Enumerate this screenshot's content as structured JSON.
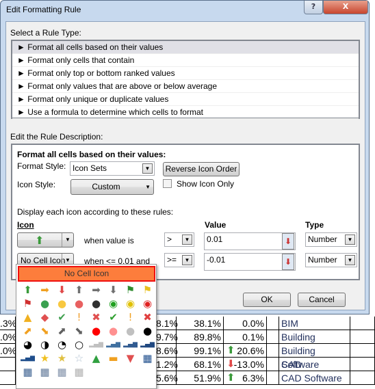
{
  "dialog": {
    "title": "Edit Formatting Rule",
    "help": "?",
    "close": "X"
  },
  "rule_type": {
    "label": "Select a Rule Type:",
    "items": [
      "► Format all cells based on their values",
      "► Format only cells that contain",
      "► Format only top or bottom ranked values",
      "► Format only values that are above or below average",
      "► Format only unique or duplicate values",
      "► Use a formula to determine which cells to format"
    ],
    "selected": 0
  },
  "description": {
    "label": "Edit the Rule Description:",
    "heading": "Format all cells based on their values:",
    "format_style_label": "Format Style:",
    "format_style": "Icon Sets",
    "reverse": "Reverse Icon Order",
    "icon_style_label": "Icon Style:",
    "icon_style": "Custom",
    "show_icon_only": "Show Icon Only",
    "show_icon_only_checked": false,
    "display_label": "Display each icon according to these rules:",
    "col_icon": "Icon",
    "col_value": "Value",
    "col_type": "Type",
    "rules": [
      {
        "icon": "green-up-arrow",
        "when": "when value is",
        "op": ">",
        "value": "0.01",
        "type": "Number"
      },
      {
        "icon": "No Cell Icon",
        "when": "when <= 0.01 and",
        "op": ">=",
        "value": "-0.01",
        "type": "Number"
      }
    ]
  },
  "buttons": {
    "ok": "OK",
    "cancel": "Cancel"
  },
  "icon_picker": {
    "selected": "No Cell Icon",
    "icons": [
      {
        "n": "green-up-arrow",
        "c": "#3a9a3a"
      },
      {
        "n": "yellow-right-arrow",
        "c": "#f0a020"
      },
      {
        "n": "red-down-arrow",
        "c": "#e04848"
      },
      {
        "n": "gray-up-arrow",
        "c": "#707070"
      },
      {
        "n": "gray-right-arrow",
        "c": "#707070"
      },
      {
        "n": "gray-down-arrow",
        "c": "#707070"
      },
      {
        "n": "green-flag",
        "c": "#2e8b2e"
      },
      {
        "n": "yellow-flag",
        "c": "#e8c020"
      },
      {
        "n": "red-flag",
        "c": "#d03030"
      },
      {
        "n": "green-circle",
        "c": "#3aa050"
      },
      {
        "n": "yellow-circle",
        "c": "#f8c840"
      },
      {
        "n": "red-circle",
        "c": "#e86060"
      },
      {
        "n": "black-circle",
        "c": "#303030"
      },
      {
        "n": "green-traffic-light",
        "c": "#20a020"
      },
      {
        "n": "yellow-traffic-light",
        "c": "#e0c000"
      },
      {
        "n": "red-traffic-light",
        "c": "#e02020"
      },
      {
        "n": "yellow-triangle",
        "c": "#f0b020"
      },
      {
        "n": "red-diamond",
        "c": "#e05050"
      },
      {
        "n": "green-check-circle",
        "c": "#40a050"
      },
      {
        "n": "yellow-exclamation-circle",
        "c": "#f0a030"
      },
      {
        "n": "red-x-circle",
        "c": "#e05050"
      },
      {
        "n": "green-check",
        "c": "#30a030"
      },
      {
        "n": "yellow-exclamation",
        "c": "#f0a020"
      },
      {
        "n": "red-x",
        "c": "#e04040"
      },
      {
        "n": "yellow-up-right-arrow",
        "c": "#f0a020"
      },
      {
        "n": "yellow-down-right-arrow",
        "c": "#f0a020"
      },
      {
        "n": "gray-up-right-arrow",
        "c": "#606060"
      },
      {
        "n": "gray-down-right-arrow",
        "c": "#606060"
      },
      {
        "n": "red-ball",
        "c": "#ff0000"
      },
      {
        "n": "pink-ball",
        "c": "#ff9090"
      },
      {
        "n": "gray-ball",
        "c": "#c0c0c0"
      },
      {
        "n": "black-ball",
        "c": "#000000"
      },
      {
        "n": "three-quarter-pie",
        "c": "#000"
      },
      {
        "n": "half-pie",
        "c": "#000"
      },
      {
        "n": "quarter-pie",
        "c": "#000"
      },
      {
        "n": "empty-pie",
        "c": "#000"
      },
      {
        "n": "signal-0-bars",
        "c": "#c0c0c0"
      },
      {
        "n": "signal-1-bar",
        "c": "#4070a0"
      },
      {
        "n": "signal-2-bars",
        "c": "#305a90"
      },
      {
        "n": "signal-3-bars",
        "c": "#204880"
      },
      {
        "n": "signal-4-bars",
        "c": "#1f4e8c"
      },
      {
        "n": "gold-star",
        "c": "#f0c020"
      },
      {
        "n": "half-star",
        "c": "#e0c040"
      },
      {
        "n": "empty-star",
        "c": "#b0c0d0"
      },
      {
        "n": "green-triangle-up",
        "c": "#30a040"
      },
      {
        "n": "yellow-dash",
        "c": "#f0a020"
      },
      {
        "n": "red-triangle-down",
        "c": "#e05050"
      },
      {
        "n": "four-boxes",
        "c": "#1f4e8c"
      },
      {
        "n": "three-boxes",
        "c": "#3a5f8f"
      },
      {
        "n": "two-boxes",
        "c": "#607898"
      },
      {
        "n": "one-box",
        "c": "#8090a8"
      },
      {
        "n": "zero-boxes",
        "c": "#b0b0b0"
      }
    ]
  },
  "sheet": {
    "rows": [
      {
        "a": ".3%",
        "b": "8.1%",
        "c": "38.1%",
        "arrow": "",
        "d": "0.0%",
        "name": "BIM"
      },
      {
        "a": ".0%",
        "b": "9.7%",
        "c": "89.8%",
        "arrow": "",
        "d": "0.1%",
        "name": "Building"
      },
      {
        "a": ".0%",
        "b": "8.6%",
        "c": "99.1%",
        "arrow": "up",
        "d": "20.6%",
        "name": "Building Software"
      },
      {
        "a": "",
        "b": "1.2%",
        "c": "68.1%",
        "arrow": "down",
        "d": "-13.0%",
        "name": "CAD"
      },
      {
        "a": "",
        "b": "5.6%",
        "c": "51.9%",
        "arrow": "up",
        "d": "6.3%",
        "name": "CAD Software"
      }
    ]
  }
}
